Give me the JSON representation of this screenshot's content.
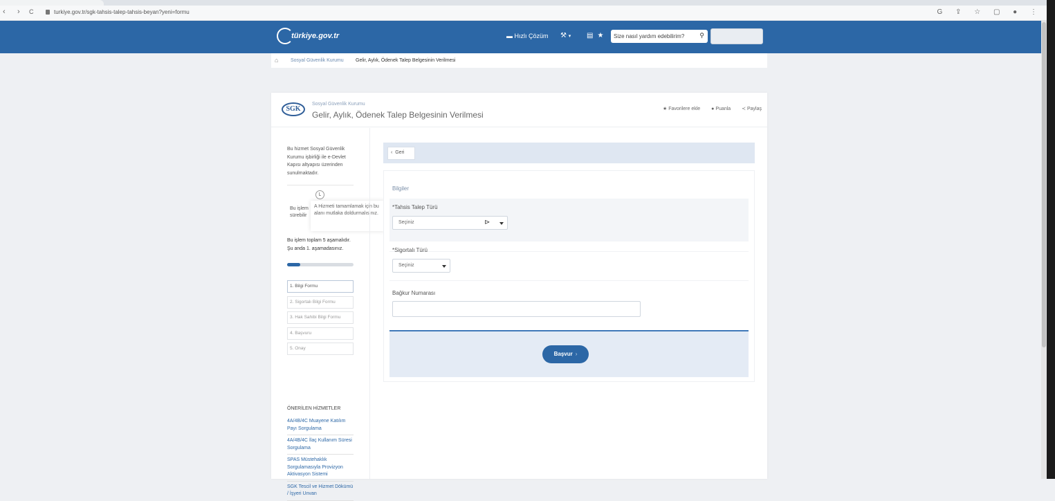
{
  "browser": {
    "url": "turkiye.gov.tr/sgk-tahsis-talep-tahsis-beyan?yeni=formu",
    "nav": [
      "‹",
      "›",
      "C"
    ],
    "right_icons": "G ⇪ ☆ ▢ ● ⋮"
  },
  "header": {
    "logo": "türkiye.gov.tr",
    "quick_solution": "Hızlı Çözüm",
    "search_placeholder": "Size nasıl yardım edebilirim?"
  },
  "breadcrumb": {
    "items": [
      "Sosyal Güvenlik Kurumu",
      "Gelir, Aylık, Ödenek Talep Belgesinin Verilmesi"
    ]
  },
  "page": {
    "org_logo": "SGK",
    "org_name": "Sosyal Güvenlik Kurumu",
    "title": "Gelir, Aylık, Ödenek Talep Belgesinin Verilmesi",
    "actions": {
      "favorite": "Favorilere ekle",
      "rate": "Puanla",
      "share": "Paylaş"
    }
  },
  "sidebar": {
    "intro": "Bu hizmet Sosyal Güvenlik Kurumu işbirliği ile e-Devlet Kapısı altyapısı üzerinden sunulmaktadır.",
    "op_note": "Bu işlem sürebilir",
    "tooltip": "A Hizmeti tamamlamak için bu alanı mutlaka doldurmalısınız.",
    "step_count": "Bu işlem toplam 5 aşamalıdır. Şu anda 1. aşamadasınız.",
    "progress": 0.2,
    "steps": [
      "1. Bilgi Formu",
      "2. Sigortalı Bilgi Formu",
      "3. Hak Sahibi Bilgi Formu",
      "4. Başvuru",
      "5. Onay"
    ],
    "recommended_title": "ÖNERİLEN HİZMETLER",
    "recommended": [
      "4A/4B/4C Muayene Katılım Payı Sorgulama",
      "4A/4B/4C İlaç Kullanım Süresi Sorgulama",
      "SPAS Müstehaklık Sorgulamasıyla Provizyon Aktivasyon Sistemi",
      "SGK Tescil ve Hizmet Dökümü / İşyeri Unvan"
    ]
  },
  "form": {
    "back": "Geri",
    "section": "Bilgiler",
    "field1_label": "*Tahsis Talep Türü",
    "field1_value": "Seçiniz",
    "field2_label": "*Sigortalı Türü",
    "field2_value": "Seçiniz",
    "field3_label": "Bağkur Numarası",
    "submit": "Başvur",
    "submit_arrow": "›"
  },
  "colors": {
    "brand_blue": "#2c67a6",
    "background": "#eef0f3"
  }
}
